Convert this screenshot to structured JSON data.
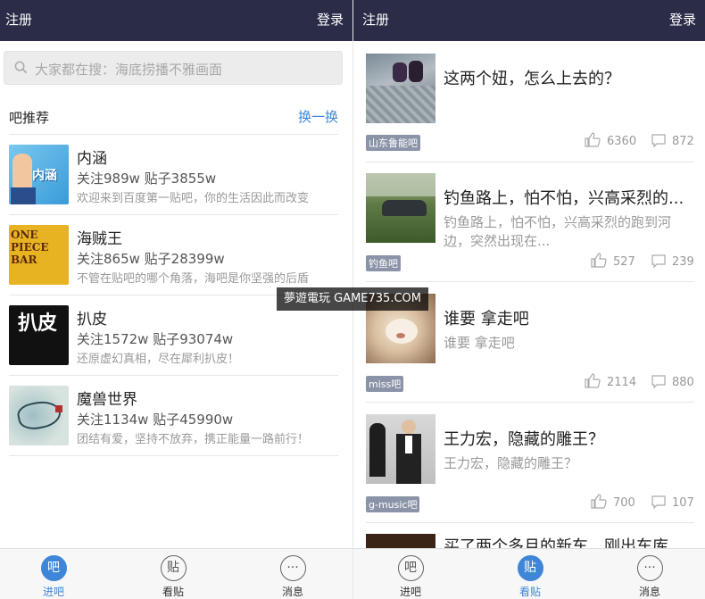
{
  "left": {
    "topbar": {
      "left": "注册",
      "right": "登录"
    },
    "search_placeholder": "大家都在搜：海底捞播不雅画面",
    "rec_title": "吧推荐",
    "rec_more": "换一换",
    "bars": [
      {
        "name": "内涵",
        "stats": "关注989w  贴子3855w",
        "desc": "欢迎来到百度第一贴吧，你的生活因此而改变",
        "thumb_text": "内涵"
      },
      {
        "name": "海贼王",
        "stats": "关注865w  贴子28399w",
        "desc": "不管在贴吧的哪个角落，海吧是你坚强的后盾",
        "thumb_text": "ONE PIECE BAR"
      },
      {
        "name": "扒皮",
        "stats": "关注1572w  贴子93074w",
        "desc": "还原虚幻真相，尽在犀利扒皮！",
        "thumb_text": "扒皮"
      },
      {
        "name": "魔兽世界",
        "stats": "关注1134w  贴子45990w",
        "desc": "团结有爱，坚持不放弃，携正能量一路前行！",
        "thumb_text": ""
      }
    ],
    "tabs": [
      {
        "icon": "吧",
        "label": "进吧",
        "active": true
      },
      {
        "icon": "贴",
        "label": "看贴",
        "active": false
      },
      {
        "icon": "···",
        "label": "消息",
        "active": false
      }
    ]
  },
  "right": {
    "topbar": {
      "left": "注册",
      "right": "登录"
    },
    "posts": [
      {
        "title": "这两个妞，怎么上去的？",
        "body": "",
        "tag": "山东鲁能吧",
        "likes": "6360",
        "comments": "872"
      },
      {
        "title": "钓鱼路上，怕不怕，兴高采烈的...",
        "body": "钓鱼路上，怕不怕，兴高采烈的跑到河边，突然出现在...",
        "tag": "钓鱼吧",
        "likes": "527",
        "comments": "239"
      },
      {
        "title": "谁要 拿走吧",
        "body": "谁要 拿走吧",
        "tag": "miss吧",
        "likes": "2114",
        "comments": "880"
      },
      {
        "title": "王力宏，隐藏的雕王？",
        "body": "王力宏，隐藏的雕王？",
        "tag": "g-music吧",
        "likes": "700",
        "comments": "107"
      },
      {
        "title": "买了两个多月的新车，刚出车库",
        "body": "",
        "tag": "",
        "likes": "",
        "comments": ""
      }
    ],
    "tabs": [
      {
        "icon": "吧",
        "label": "进吧",
        "active": false
      },
      {
        "icon": "贴",
        "label": "看贴",
        "active": true
      },
      {
        "icon": "···",
        "label": "消息",
        "active": false
      }
    ]
  },
  "watermark": "夢遊電玩 GAME735.COM",
  "colors": {
    "topbar": "#2b2d48",
    "accent": "#3f86d8",
    "tag": "#8a93a8"
  }
}
